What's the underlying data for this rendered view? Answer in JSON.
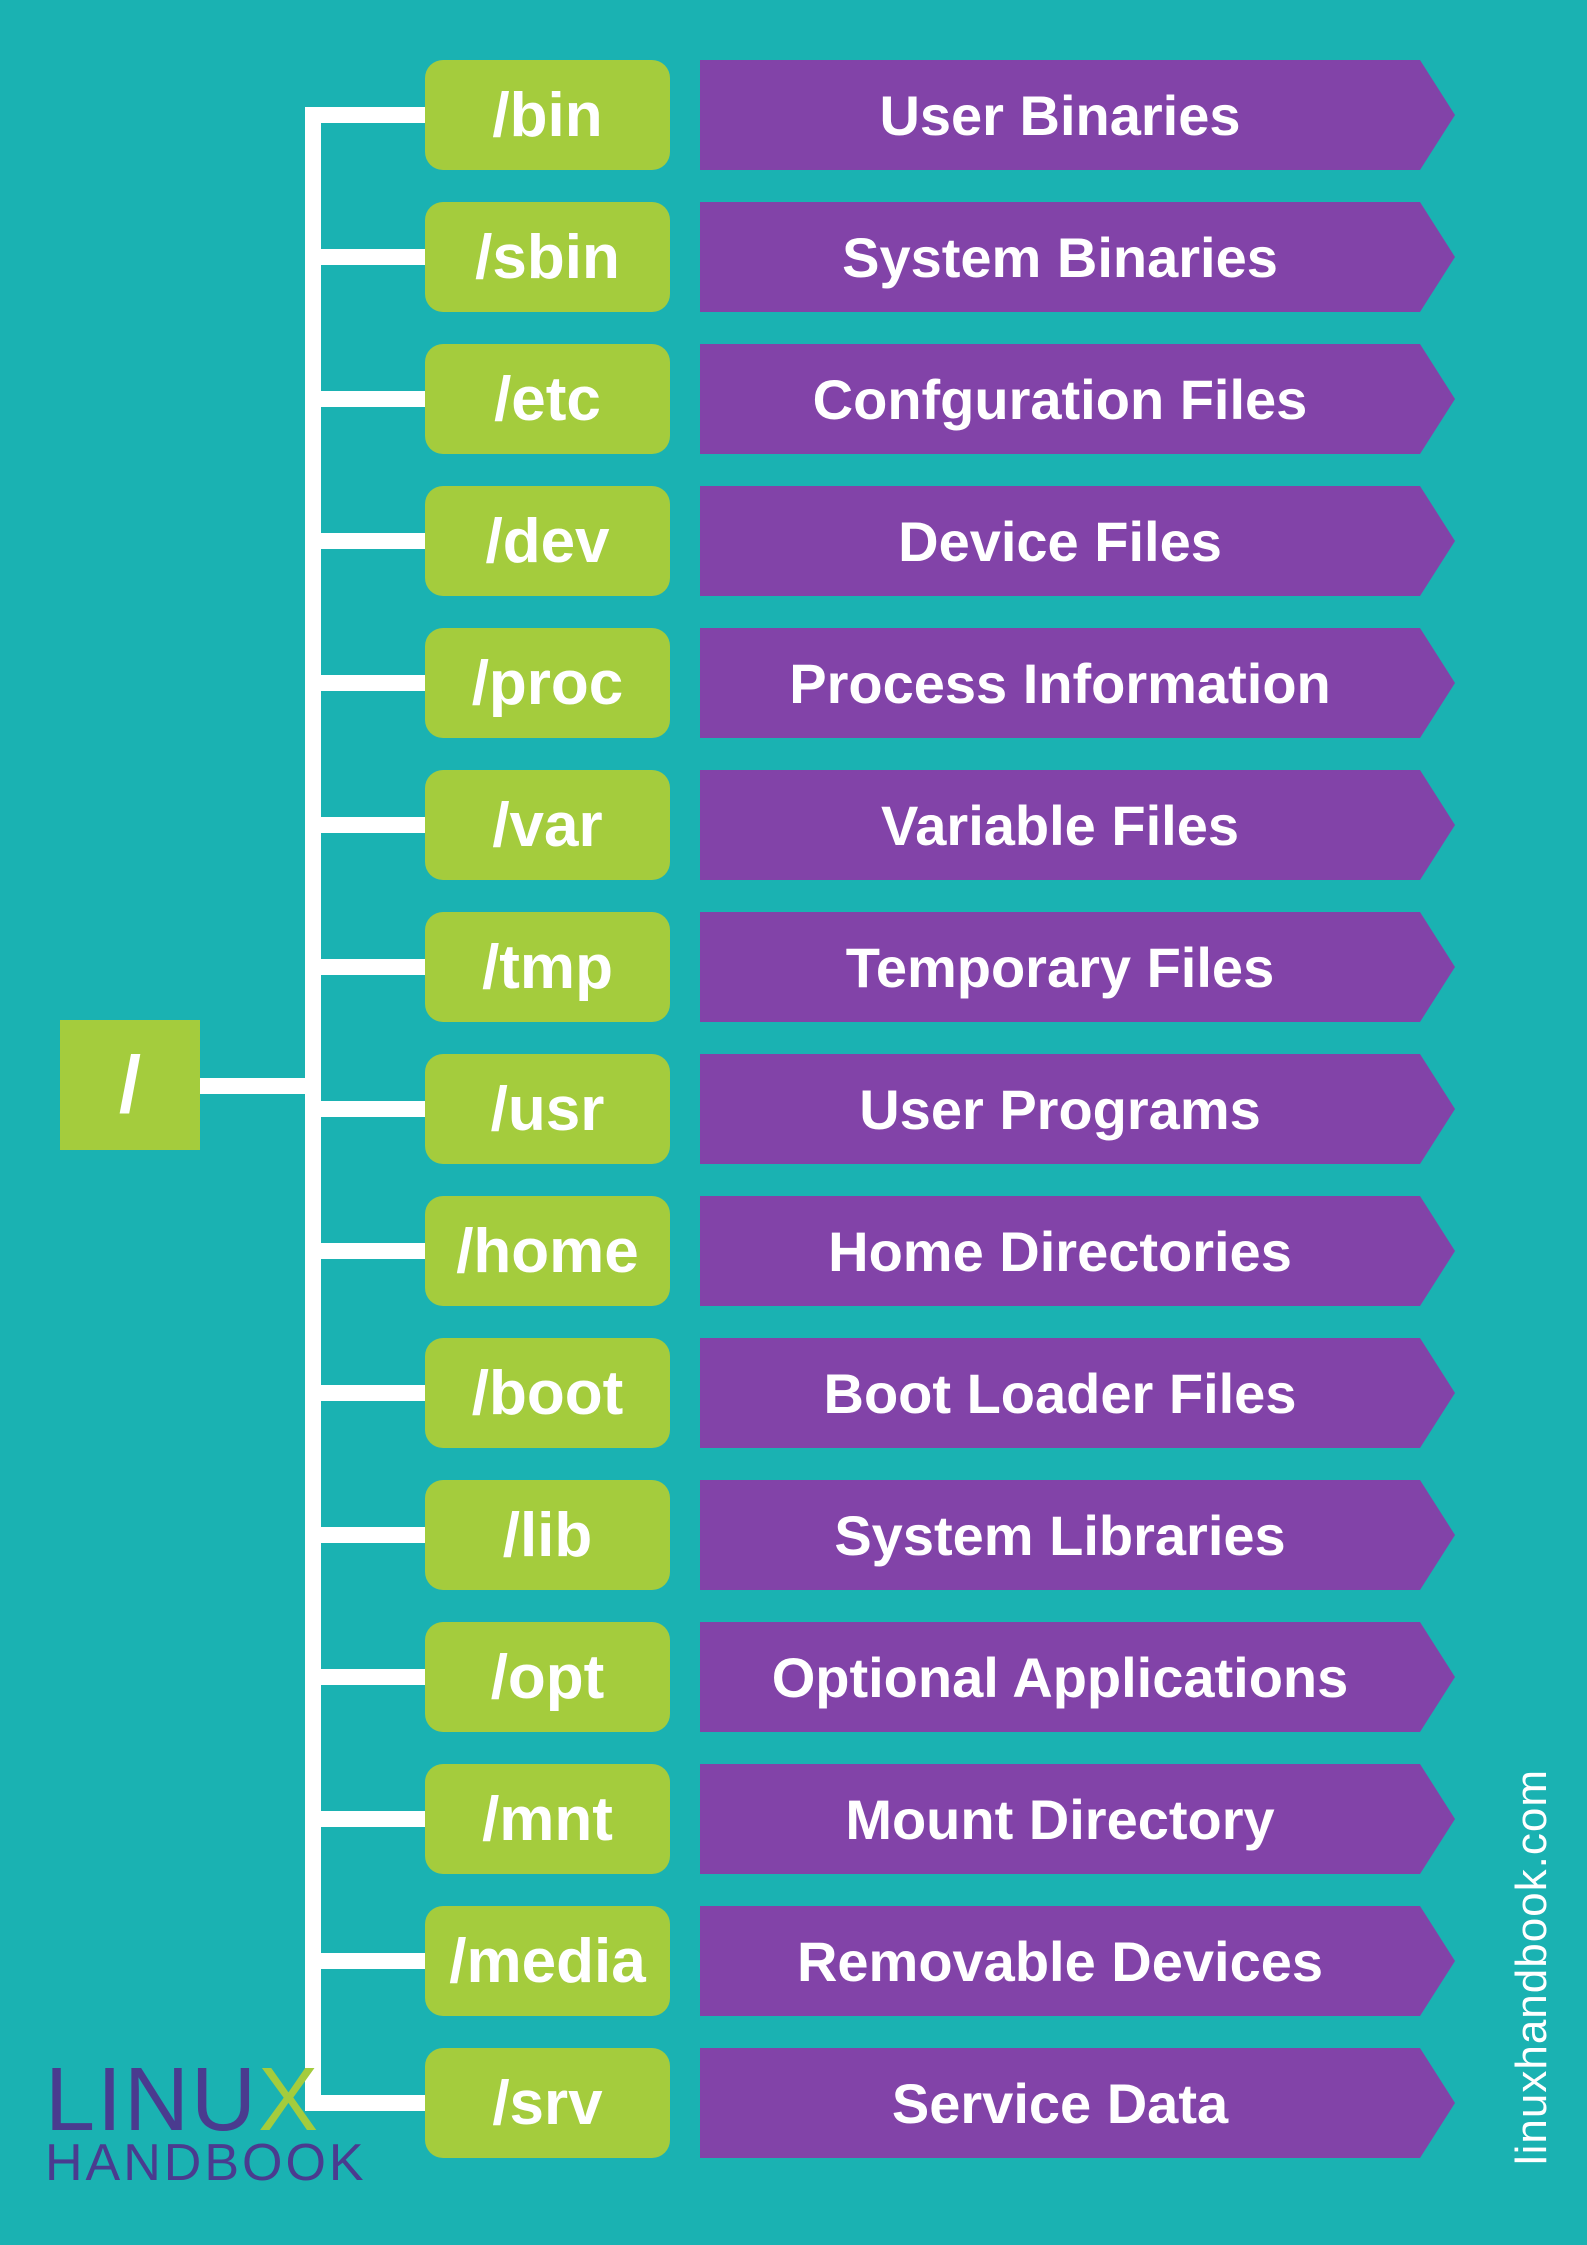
{
  "root": "/",
  "items": [
    {
      "dir": "/bin",
      "desc": "User Binaries"
    },
    {
      "dir": "/sbin",
      "desc": "System Binaries"
    },
    {
      "dir": "/etc",
      "desc": "Confguration Files"
    },
    {
      "dir": "/dev",
      "desc": "Device Files"
    },
    {
      "dir": "/proc",
      "desc": "Process Information"
    },
    {
      "dir": "/var",
      "desc": "Variable Files"
    },
    {
      "dir": "/tmp",
      "desc": "Temporary Files"
    },
    {
      "dir": "/usr",
      "desc": "User Programs"
    },
    {
      "dir": "/home",
      "desc": "Home Directories"
    },
    {
      "dir": "/boot",
      "desc": "Boot Loader Files"
    },
    {
      "dir": "/lib",
      "desc": "System Libraries"
    },
    {
      "dir": "/opt",
      "desc": "Optional Applications"
    },
    {
      "dir": "/mnt",
      "desc": "Mount Directory"
    },
    {
      "dir": "/media",
      "desc": "Removable Devices"
    },
    {
      "dir": "/srv",
      "desc": "Service Data"
    }
  ],
  "logo": {
    "top1": "LINU",
    "topX": "X",
    "bottom": "HANDBOOK"
  },
  "url": "linuxhandbook.com"
}
